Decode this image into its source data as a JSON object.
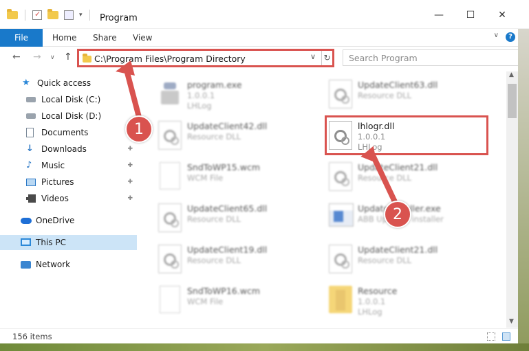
{
  "window": {
    "title": "Program",
    "minimize_glyph": "—",
    "maximize_glyph": "☐",
    "close_glyph": "✕"
  },
  "ribbon": {
    "tabs": [
      "File",
      "Home",
      "Share",
      "View"
    ],
    "help_glyph": "?",
    "collapse_glyph": "∨"
  },
  "nav": {
    "back_glyph": "←",
    "forward_glyph": "→",
    "recent_glyph": "∨",
    "up_glyph": "↑",
    "address_path": "C:\\Program Files\\Program Directory",
    "dropdown_glyph": "∨",
    "refresh_glyph": "↻",
    "search_placeholder": "Search Program"
  },
  "sidebar": {
    "items": [
      {
        "label": "Quick access",
        "icon": "star-icon"
      },
      {
        "label": "Local Disk (C:)",
        "icon": "disk-icon"
      },
      {
        "label": "Local Disk (D:)",
        "icon": "disk-icon"
      },
      {
        "label": "Documents",
        "icon": "documents-icon"
      },
      {
        "label": "Downloads",
        "icon": "downloads-icon",
        "pinned": true
      },
      {
        "label": "Music",
        "icon": "music-icon",
        "pinned": true
      },
      {
        "label": "Pictures",
        "icon": "pictures-icon",
        "pinned": true
      },
      {
        "label": "Videos",
        "icon": "videos-icon",
        "pinned": true
      },
      {
        "label": "OneDrive",
        "icon": "onedrive-icon"
      },
      {
        "label": "This PC",
        "icon": "this-pc-icon",
        "selected": true
      },
      {
        "label": "Network",
        "icon": "network-icon"
      }
    ],
    "pin_glyph": "📌"
  },
  "files": [
    {
      "name": "program.exe",
      "sub1": "1.0.0.1",
      "sub2": "LHLog",
      "type": "exe"
    },
    {
      "name": "UpdateClient63.dll",
      "sub1": "Resource DLL",
      "sub2": "",
      "type": "dll"
    },
    {
      "name": "UpdateClient42.dll",
      "sub1": "Resource DLL",
      "sub2": "",
      "type": "dll"
    },
    {
      "name": "lhlogr.dll",
      "sub1": "1.0.0.1",
      "sub2": "LHLog",
      "type": "dll",
      "highlighted": true
    },
    {
      "name": "SndToWP15.wcm",
      "sub1": "WCM File",
      "sub2": "",
      "type": "wcm"
    },
    {
      "name": "UpdateClient21.dll",
      "sub1": "Resource DLL",
      "sub2": "",
      "type": "dll"
    },
    {
      "name": "UpdateClient65.dll",
      "sub1": "Resource DLL",
      "sub2": "",
      "type": "dll"
    },
    {
      "name": "UpdateInstaller.exe",
      "sub1": "ABB Updates installer",
      "sub2": "",
      "type": "installer"
    },
    {
      "name": "UpdateClient19.dll",
      "sub1": "Resource DLL",
      "sub2": "",
      "type": "dll"
    },
    {
      "name": "UpdateClient21.dll",
      "sub1": "Resource DLL",
      "sub2": "",
      "type": "dll"
    },
    {
      "name": "SndToWP16.wcm",
      "sub1": "WCM File",
      "sub2": "",
      "type": "wcm"
    },
    {
      "name": "Resource",
      "sub1": "1.0.0.1",
      "sub2": "LHLog",
      "type": "folder"
    }
  ],
  "status": {
    "item_count": "156 items"
  },
  "annotations": {
    "step1": "1",
    "step2": "2",
    "color": "#d9534f"
  },
  "colors": {
    "accent": "#1979ca",
    "selection": "#cce4f7",
    "highlight_border": "#d9534f"
  }
}
